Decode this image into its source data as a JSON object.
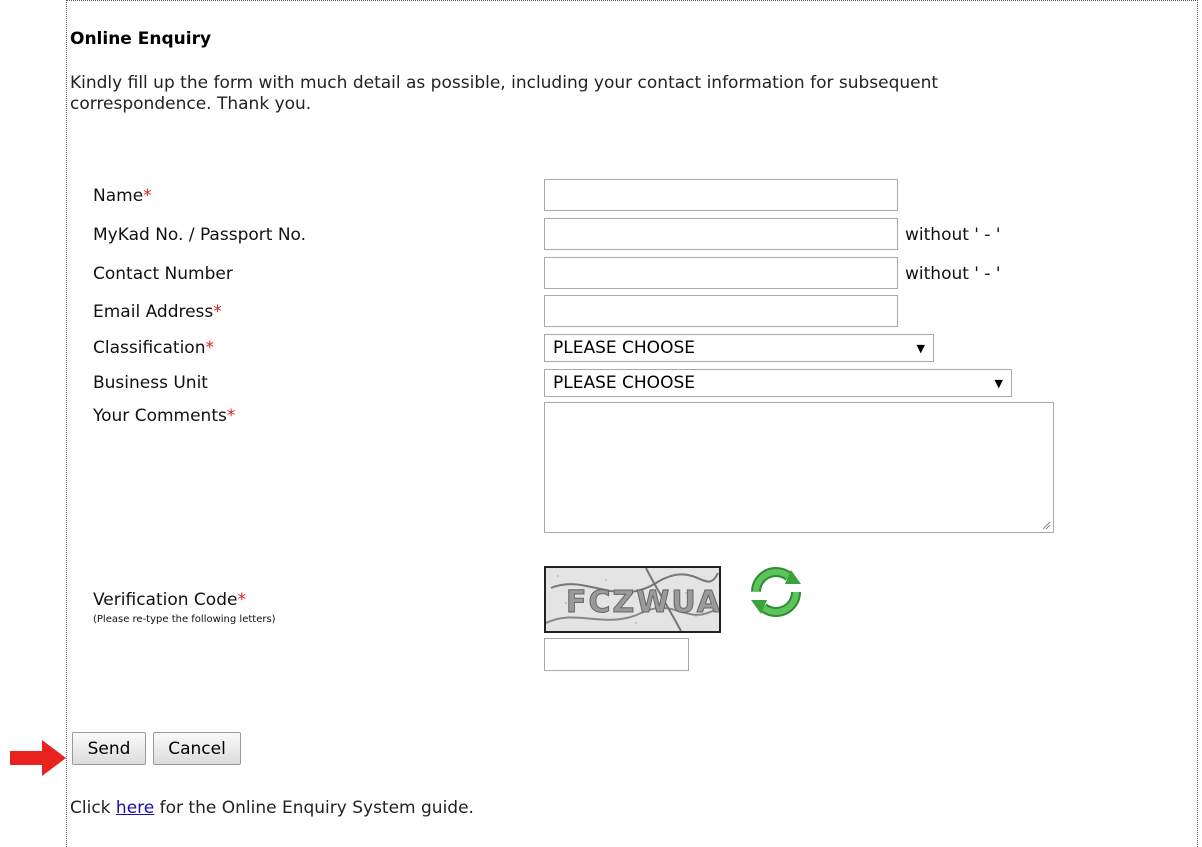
{
  "heading": "Online Enquiry",
  "intro": "Kindly fill up the form with much detail as possible, including your contact information for subsequent correspondence. Thank you.",
  "form": {
    "name_label": "Name",
    "mykad_label": "MyKad No. / Passport No.",
    "mykad_hint": "without ' - '",
    "contact_label": "Contact Number",
    "contact_hint": "without ' - '",
    "email_label": "Email Address",
    "classification_label": "Classification",
    "classification_value": "PLEASE CHOOSE",
    "business_unit_label": "Business Unit",
    "business_unit_value": "PLEASE CHOOSE",
    "comments_label": "Your Comments",
    "verification_label": "Verification Code",
    "verification_note": "(Please re-type the following letters)",
    "captcha_text": "FCZWUA",
    "required_mark": "*"
  },
  "buttons": {
    "send": "Send",
    "cancel": "Cancel"
  },
  "footer": {
    "prefix": "Click ",
    "link": "here",
    "suffix": " for the Online Enquiry System guide."
  },
  "colors": {
    "required": "#e02020",
    "link": "#1a0dab",
    "arrow": "#e8231f",
    "refresh": "#3aa33a"
  }
}
